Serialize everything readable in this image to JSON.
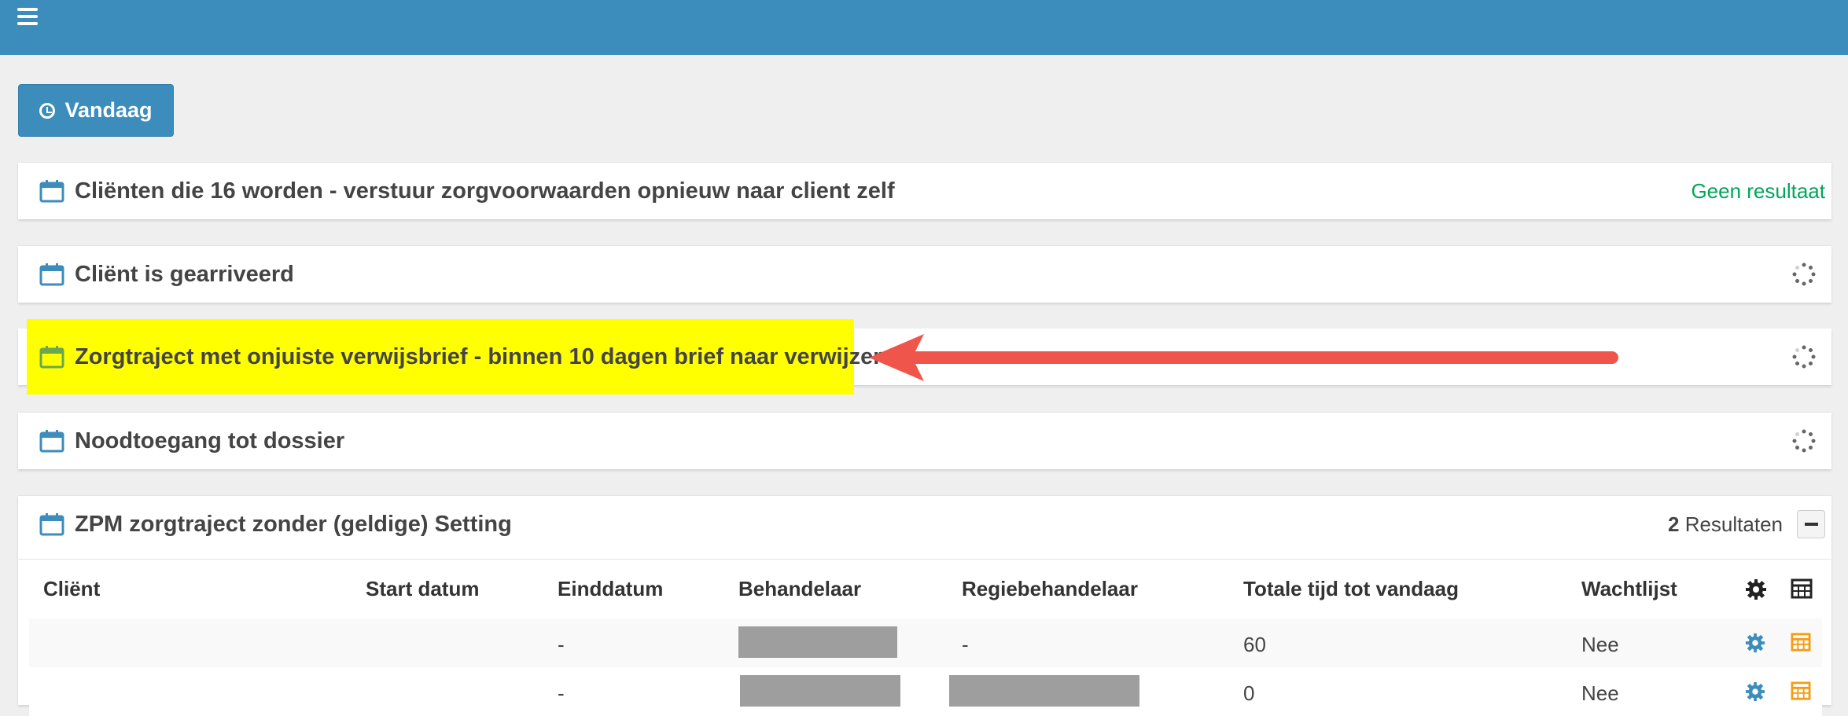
{
  "header": {
    "menu_icon": "hamburger-icon",
    "color": "#3c8dbc"
  },
  "toolbar": {
    "today_label": "Vandaag",
    "today_icon": "clock-icon"
  },
  "panels": [
    {
      "title": "Cliënten die 16 worden - verstuur zorgvoorwaarden opnieuw naar client zelf",
      "status": "Geen resultaat"
    },
    {
      "title": "Cliënt is gearriveerd",
      "status_icon": "loading-spinner-icon"
    },
    {
      "title": "Zorgtraject met onjuiste verwijsbrief - binnen 10 dagen brief naar verwijzer",
      "status_icon": "loading-spinner-icon",
      "highlighted": true
    },
    {
      "title": "Noodtoegang tot dossier",
      "status_icon": "loading-spinner-icon"
    },
    {
      "title": "ZPM zorgtraject zonder (geldige) Setting",
      "count": "2",
      "count_label": "Resultaten"
    }
  ],
  "table": {
    "columns": [
      "Cliënt",
      "Start datum",
      "Einddatum",
      "Behandelaar",
      "Regiebehandelaar",
      "Totale tijd tot vandaag",
      "Wachtlijst"
    ],
    "rows": [
      {
        "einddatum": "-",
        "regiebehandelaar": "-",
        "totale_tijd": "60",
        "wachtlijst": "Nee"
      },
      {
        "einddatum": "-",
        "totale_tijd": "0",
        "wachtlijst": "Nee"
      }
    ]
  },
  "colors": {
    "accent": "#3c8dbc",
    "success": "#00a65a",
    "highlight": "#ffff00",
    "arrow": "#f0554b",
    "table_icon": "#f39c12"
  }
}
